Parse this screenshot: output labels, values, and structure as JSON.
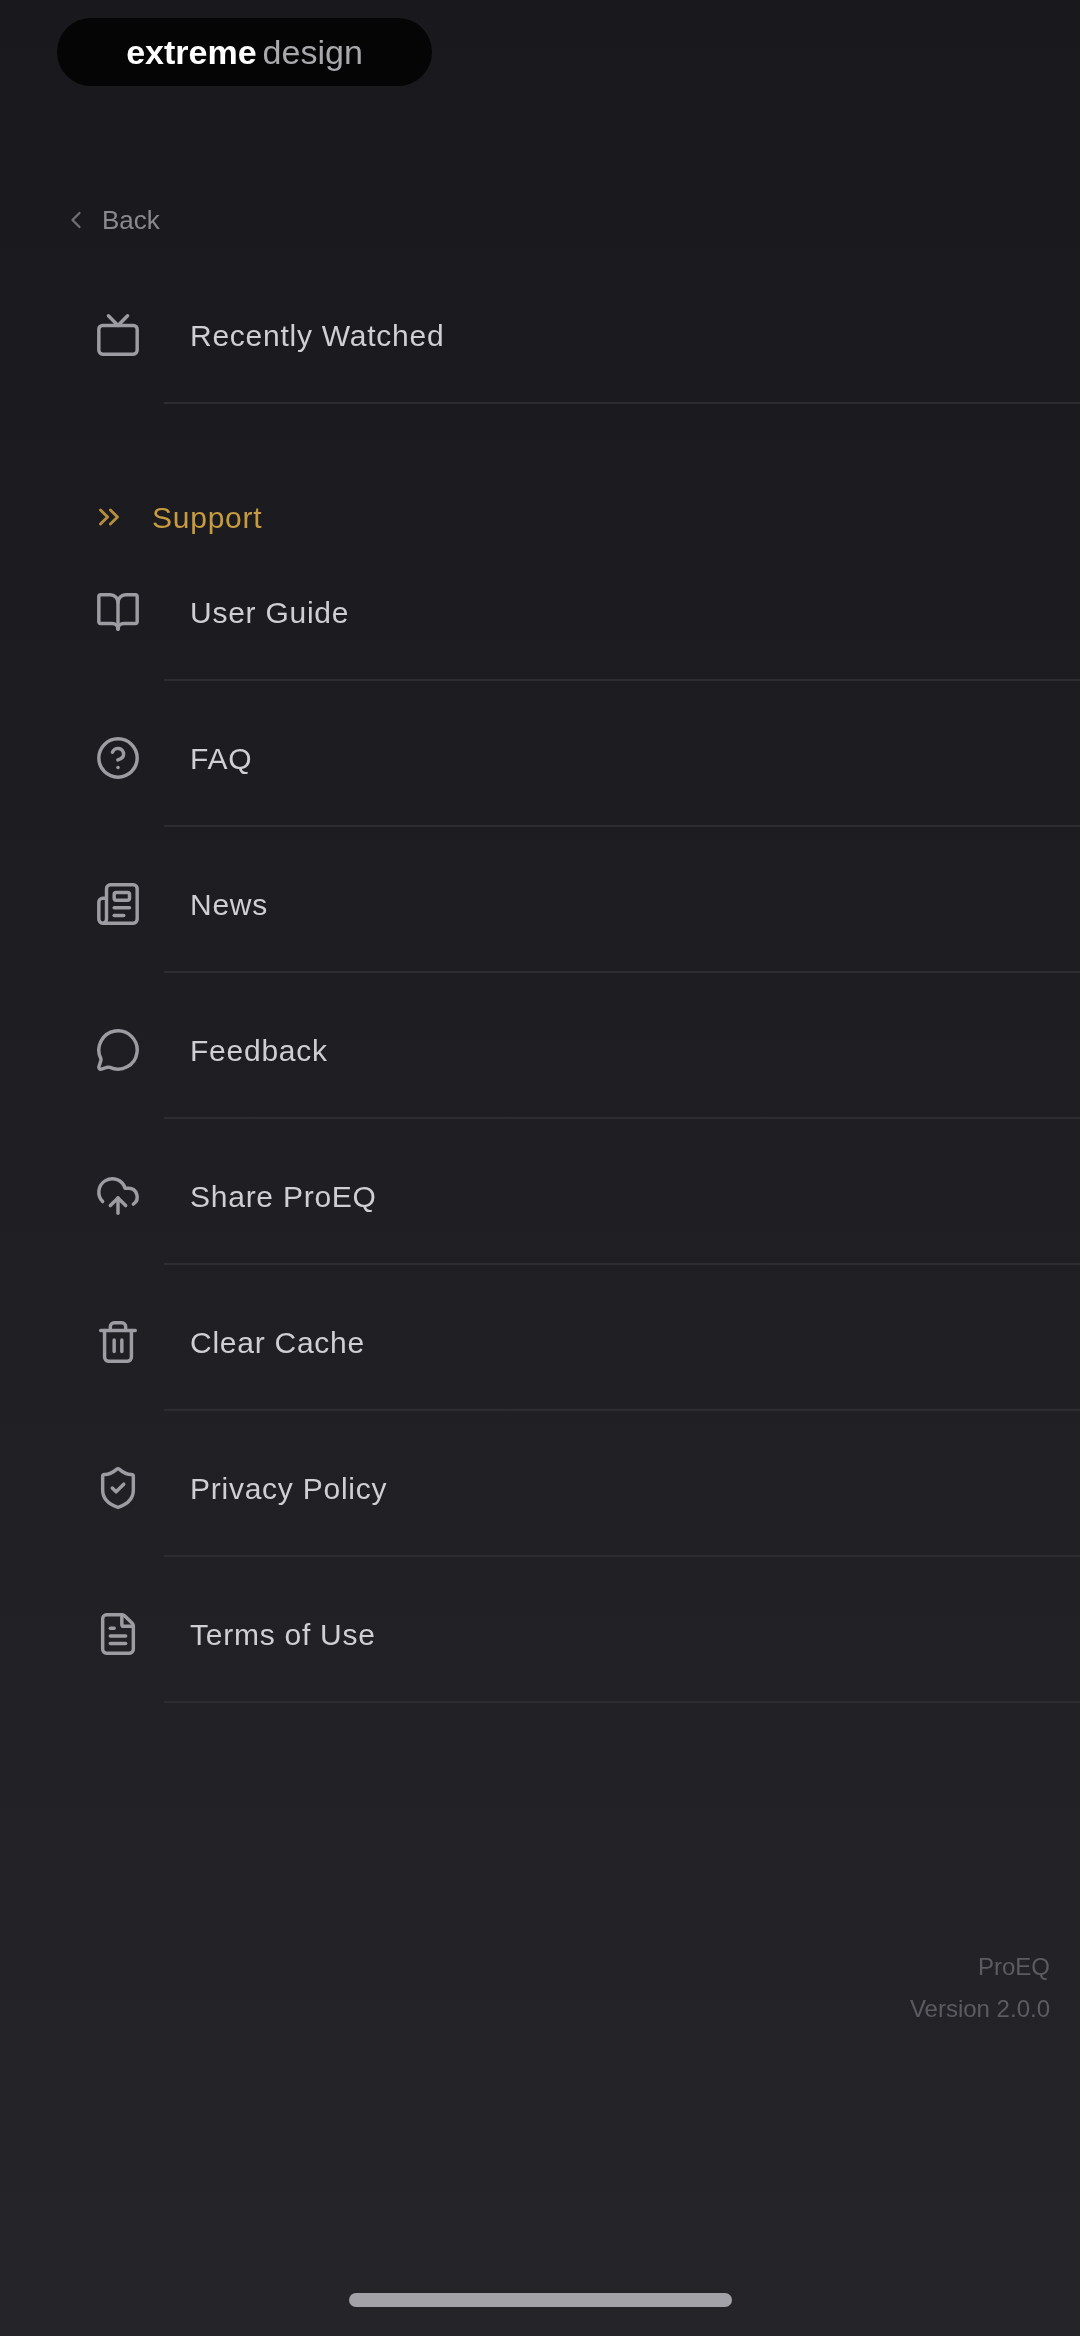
{
  "logo": {
    "brand": "extreme",
    "suffix": "design"
  },
  "back": {
    "label": "Back"
  },
  "history": [
    {
      "label": "Recently Watched"
    }
  ],
  "support": {
    "title": "Support",
    "items": [
      {
        "label": "User Guide"
      },
      {
        "label": "FAQ"
      },
      {
        "label": "News"
      },
      {
        "label": "Feedback"
      },
      {
        "label": "Share ProEQ"
      },
      {
        "label": "Clear Cache"
      },
      {
        "label": "Privacy Policy"
      },
      {
        "label": "Terms of Use"
      }
    ]
  },
  "footer": {
    "app_name": "ProEQ",
    "version": "Version 2.0.0"
  }
}
